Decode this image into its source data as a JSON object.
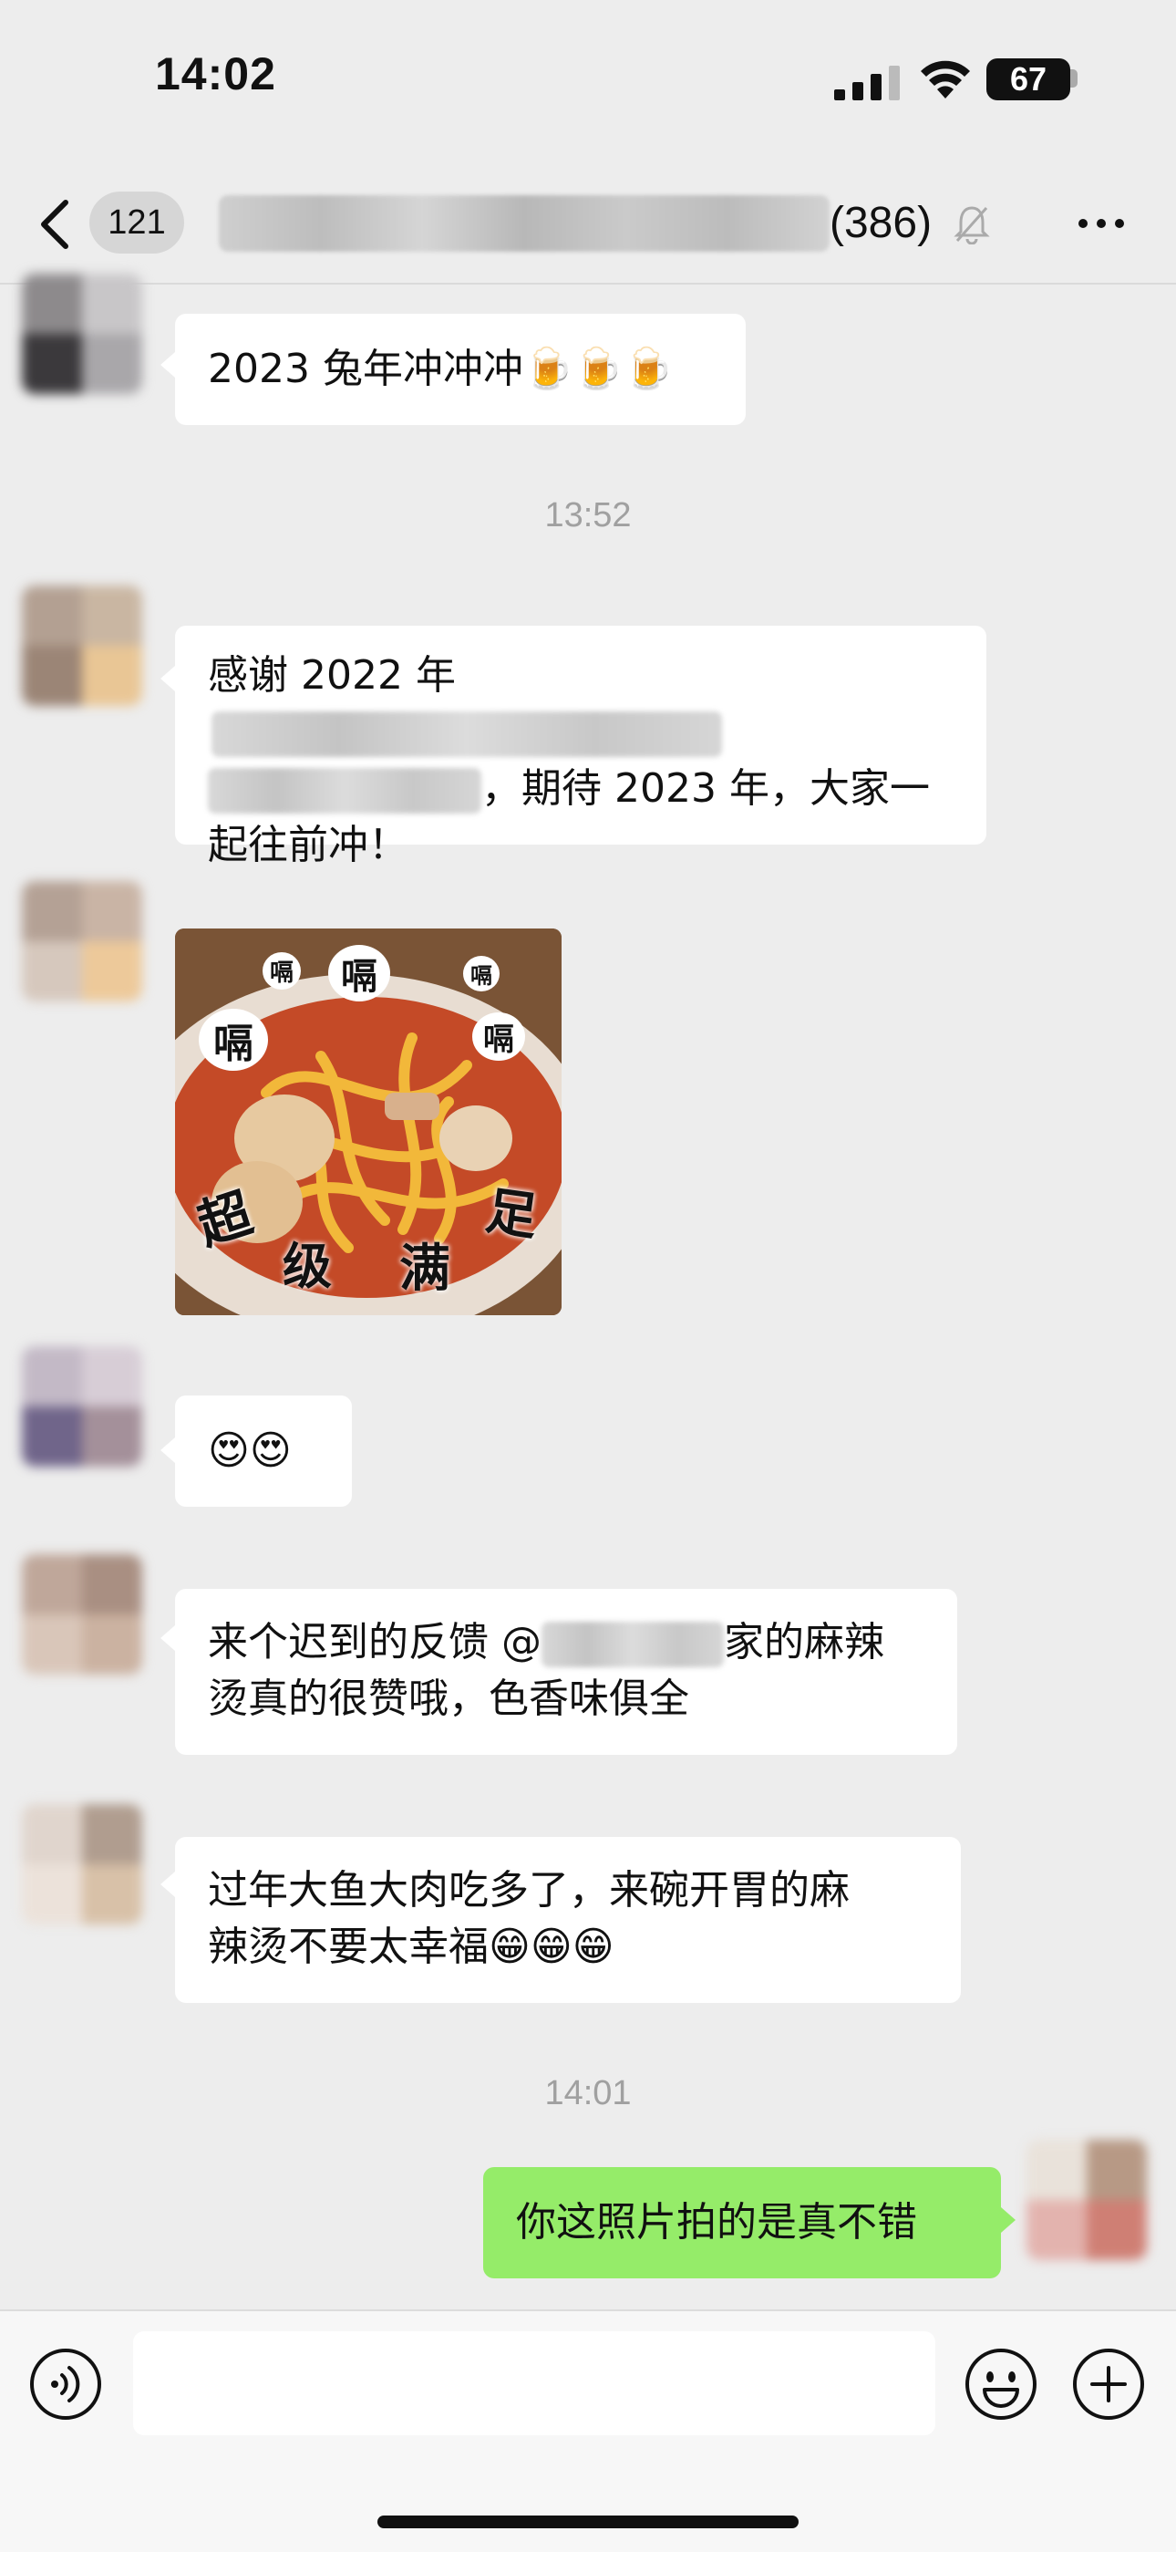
{
  "status_bar": {
    "time": "14:02",
    "battery": "67",
    "icons": [
      "signal-icon",
      "wifi-icon",
      "battery-icon"
    ]
  },
  "nav": {
    "back_badge": "121",
    "title_count": "(386)",
    "icons": [
      "back-arrow-icon",
      "mute-bell-icon",
      "more-icon"
    ]
  },
  "messages": [
    {
      "type": "text",
      "sender": "other",
      "text": "2023 兔年冲冲冲🍺🍺🍺"
    },
    {
      "type": "timestamp",
      "text": "13:52"
    },
    {
      "type": "text",
      "sender": "other",
      "line1": "感谢 2022 年",
      "line2_tail": "，期待 2023 年，大家一",
      "line3": "起往前冲！"
    },
    {
      "type": "sticker",
      "sender": "other",
      "captions": [
        "嗝",
        "嗝",
        "嗝",
        "嗝",
        "嗝"
      ],
      "words": [
        "超",
        "级",
        "满",
        "足"
      ]
    },
    {
      "type": "text",
      "sender": "other",
      "text": "😍😍"
    },
    {
      "type": "text",
      "sender": "other",
      "line1_head": "来个迟到的反馈 @",
      "line1_tail": "家的麻辣",
      "line2": "烫真的很赞哦，色香味俱全"
    },
    {
      "type": "text",
      "sender": "other",
      "line1": "过年大鱼大肉吃多了，来碗开胃的麻",
      "line2": "辣烫不要太幸福😁😁😁"
    },
    {
      "type": "timestamp",
      "text": "14:01"
    },
    {
      "type": "text",
      "sender": "self",
      "text": "你这照片拍的是真不错"
    }
  ],
  "input_bar": {
    "value": "",
    "icons": [
      "voice-icon",
      "emoji-icon",
      "plus-icon"
    ]
  },
  "colors": {
    "self_bubble": "#95ec69",
    "other_bubble": "#ffffff",
    "background": "#ededed"
  }
}
